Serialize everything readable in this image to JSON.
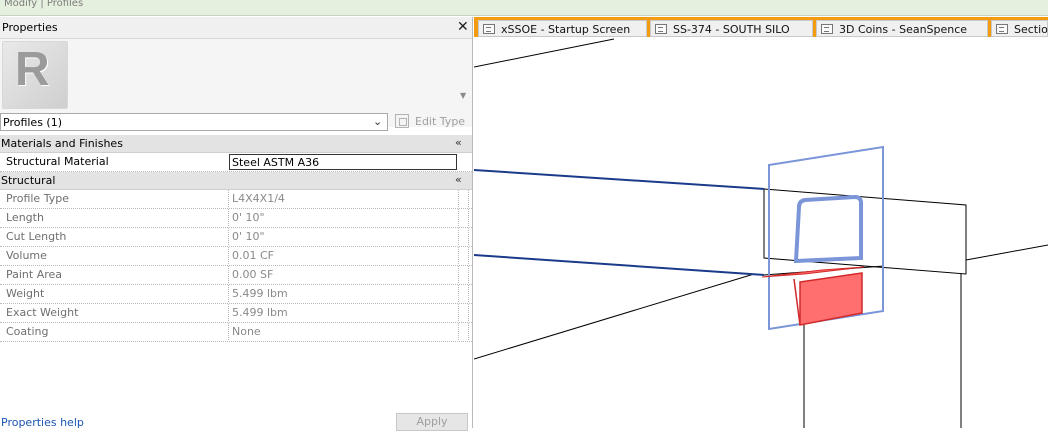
{
  "topbar": {
    "text": "Modify | Profiles"
  },
  "panel": {
    "title": "Properties",
    "close": "✕",
    "selector": "Profiles (1)",
    "edit_type": "Edit Type",
    "help": "Properties help",
    "apply": "Apply"
  },
  "groups": {
    "materials": "Materials and Finishes",
    "structural": "Structural"
  },
  "props": {
    "structural_material": {
      "name": "Structural Material",
      "value": "Steel ASTM A36"
    },
    "rows": [
      {
        "name": "Profile Type",
        "value": "L4X4X1/4"
      },
      {
        "name": "Length",
        "value": "0'  10\""
      },
      {
        "name": "Cut Length",
        "value": "0'  10\""
      },
      {
        "name": "Volume",
        "value": "0.01 CF"
      },
      {
        "name": "Paint Area",
        "value": "0.00 SF"
      },
      {
        "name": "Weight",
        "value": "5.499 lbm"
      },
      {
        "name": "Exact Weight",
        "value": "5.499 lbm"
      },
      {
        "name": "Coating",
        "value": "None"
      }
    ]
  },
  "tabs": [
    {
      "label": "xSSOE - Startup Screen"
    },
    {
      "label": "SS-374 - SOUTH SILO"
    },
    {
      "label": "3D Coins - SeanSpence"
    },
    {
      "label": "Sectio"
    }
  ],
  "colors": {
    "accent": "#f39c12",
    "selection": "#ff6f6f",
    "outline": "#7a95d8",
    "beam": "#1a3a8a"
  }
}
